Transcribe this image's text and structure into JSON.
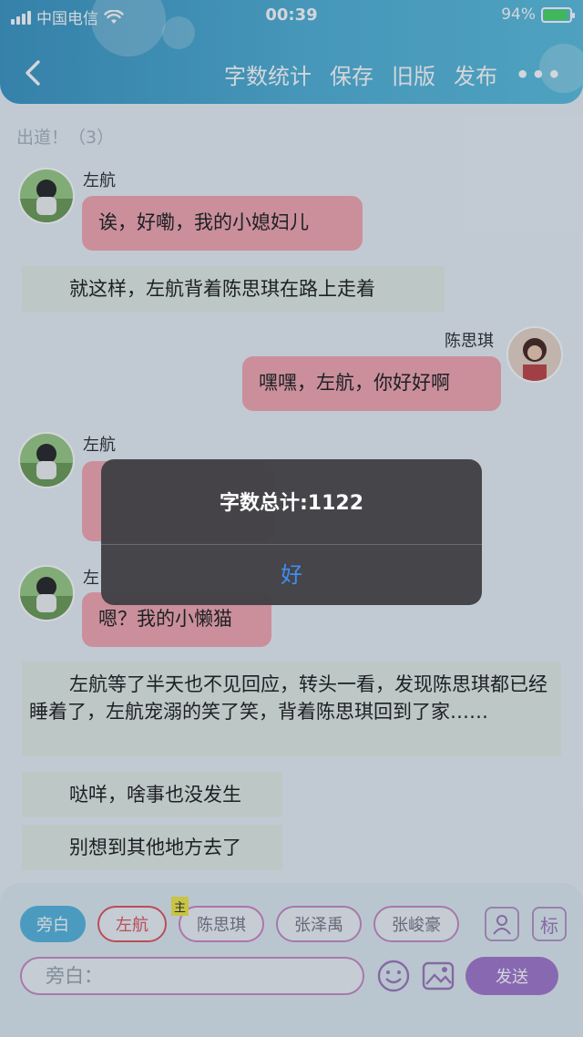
{
  "status": {
    "carrier": "中国电信",
    "time": "00:39",
    "battery": "94%"
  },
  "nav": {
    "actions": [
      "字数统计",
      "保存",
      "旧版",
      "发布"
    ],
    "more": "•••"
  },
  "chat": {
    "faded_header": "出道！（3）",
    "messages": [
      {
        "speaker": "左航",
        "text": "诶，好嘞，我的小媳妇儿"
      },
      {
        "narration": "就这样，左航背着陈思琪在路上走着"
      },
      {
        "speaker": "陈思琪",
        "text": "嘿嘿，左航，你好好啊"
      },
      {
        "speaker": "左航",
        "text": ""
      },
      {
        "speaker": "左",
        "text": "嗯？我的小懒猫"
      },
      {
        "narration": "左航等了半天也不见回应，转头一看，发现陈思琪都已经睡着了，左航宠溺的笑了笑，背着陈思琪回到了家……"
      },
      {
        "narration": "哒咩，啥事也没发生"
      },
      {
        "narration": "别想到其他地方去了"
      }
    ]
  },
  "dialog": {
    "title": "字数总计:1122",
    "ok": "好"
  },
  "composer": {
    "roles": [
      "旁白",
      "左航",
      "陈思琪",
      "张泽禹",
      "张峻豪"
    ],
    "host_tag": "主",
    "icon_profile": "person-icon",
    "icon_label": "标",
    "placeholder": "旁白：",
    "send": "发送"
  }
}
